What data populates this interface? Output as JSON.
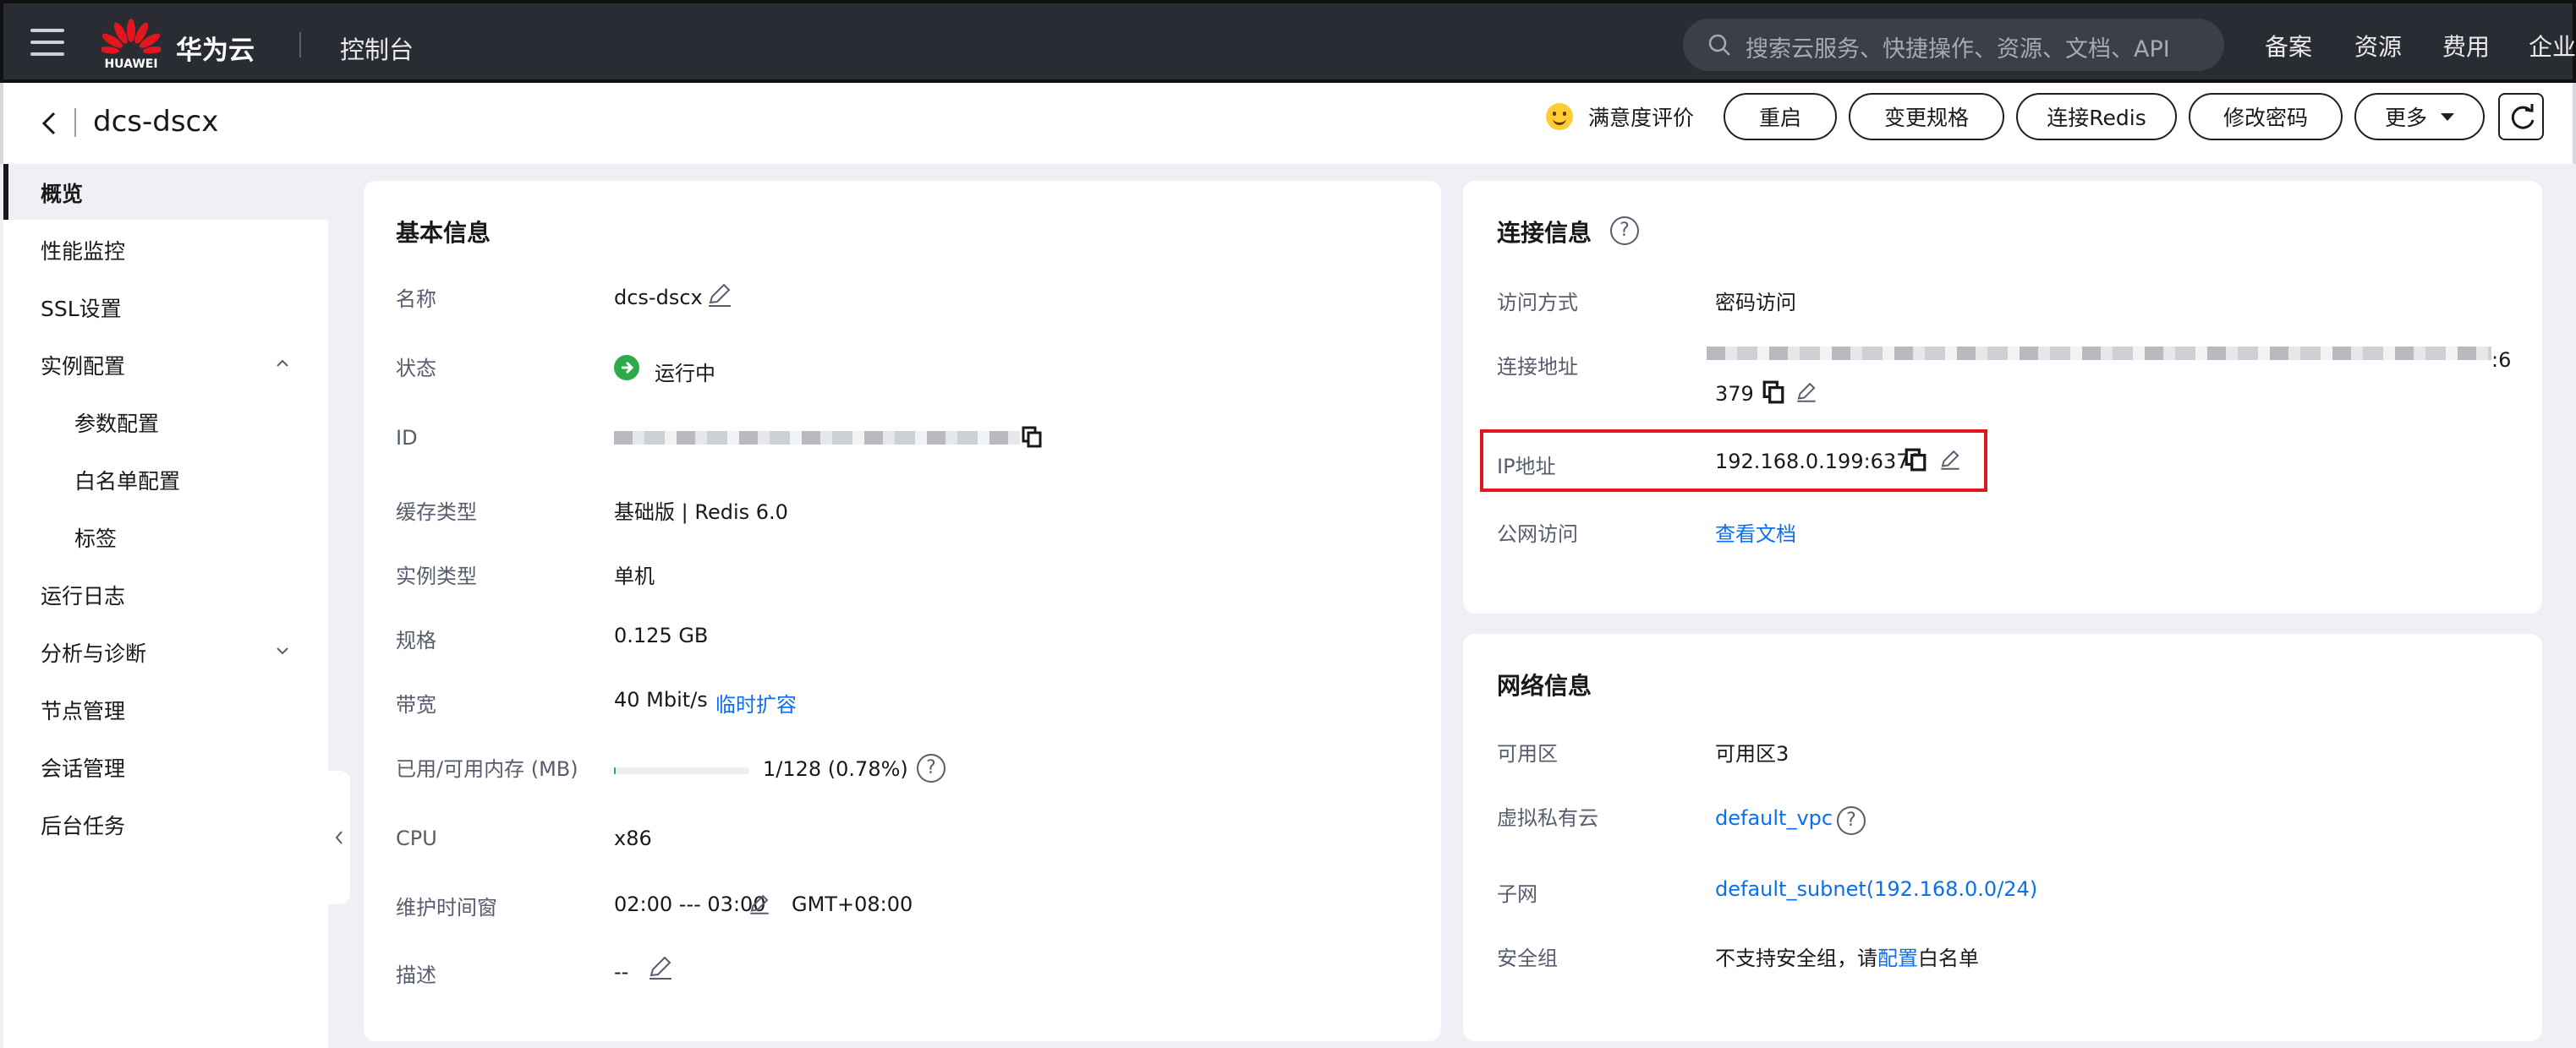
{
  "topbar": {
    "logo_text": "HUAWEI",
    "brand": "华为云",
    "console": "控制台",
    "search_placeholder": "搜索云服务、快捷操作、资源、文档、API",
    "nav": [
      "备案",
      "资源",
      "费用",
      "企业"
    ]
  },
  "header": {
    "instance_name": "dcs-dscx",
    "satisfaction": "满意度评价",
    "buttons": [
      "重启",
      "变更规格",
      "连接Redis",
      "修改密码",
      "更多"
    ]
  },
  "sidebar": {
    "items": [
      {
        "label": "概览",
        "active": true
      },
      {
        "label": "性能监控"
      },
      {
        "label": "SSL设置"
      },
      {
        "label": "实例配置",
        "expanded": true
      },
      {
        "label": "参数配置",
        "sub": true
      },
      {
        "label": "白名单配置",
        "sub": true
      },
      {
        "label": "标签",
        "sub": true
      },
      {
        "label": "运行日志"
      },
      {
        "label": "分析与诊断",
        "expanded": false
      },
      {
        "label": "节点管理"
      },
      {
        "label": "会话管理"
      },
      {
        "label": "后台任务"
      }
    ]
  },
  "basic": {
    "title": "基本信息",
    "name_label": "名称",
    "name_value": "dcs-dscx",
    "status_label": "状态",
    "status_value": "运行中",
    "id_label": "ID",
    "cache_type_label": "缓存类型",
    "cache_type_value": "基础版 | Redis 6.0",
    "instance_type_label": "实例类型",
    "instance_type_value": "单机",
    "spec_label": "规格",
    "spec_value": "0.125 GB",
    "bandwidth_label": "带宽",
    "bandwidth_value": "40 Mbit/s",
    "bandwidth_link": "临时扩容",
    "memory_label": "已用/可用内存 (MB)",
    "memory_value": "1/128 (0.78%)",
    "memory_fraction": 0.0078,
    "cpu_label": "CPU",
    "cpu_value": "x86",
    "maintenance_label": "维护时间窗",
    "maintenance_value": "02:00 --- 03:00",
    "maintenance_tz": "GMT+08:00",
    "desc_label": "描述",
    "desc_value": "--"
  },
  "connection": {
    "title": "连接信息",
    "access_label": "访问方式",
    "access_value": "密码访问",
    "address_label": "连接地址",
    "address_tail_1": ":6",
    "address_tail_2": "379",
    "ip_label": "IP地址",
    "ip_value": "192.168.0.199:6379",
    "public_label": "公网访问",
    "public_link": "查看文档"
  },
  "network": {
    "title": "网络信息",
    "az_label": "可用区",
    "az_value": "可用区3",
    "vpc_label": "虚拟私有云",
    "vpc_value": "default_vpc",
    "subnet_label": "子网",
    "subnet_value": "default_subnet(192.168.0.0/24)",
    "sg_label": "安全组",
    "sg_prefix": "不支持安全组，请",
    "sg_link": "配置",
    "sg_suffix": "白名单"
  },
  "colors": {
    "topbar_bg": "#2a2c33",
    "link": "#0a6ff0",
    "status_green": "#2faa4a",
    "highlight_red": "#e3151f"
  }
}
